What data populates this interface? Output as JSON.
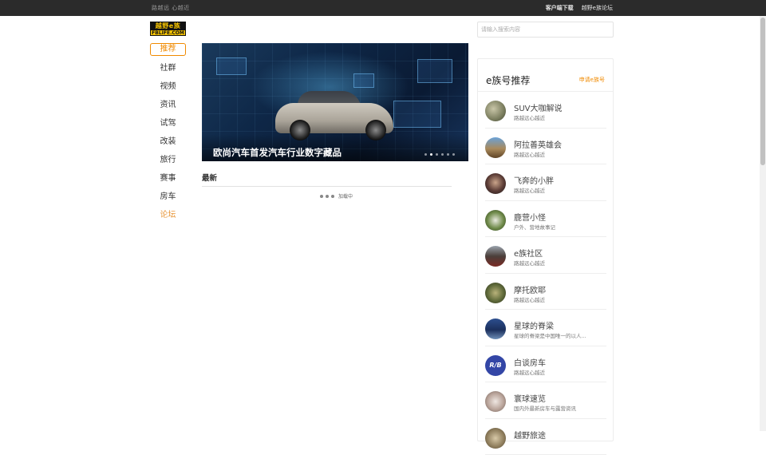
{
  "topbar": {
    "slogan": "路越远 心越近",
    "client_download": "客户端下载",
    "forum": "越野e族论坛"
  },
  "logo": {
    "cn": "越野e族",
    "en": "FBLIFE.COM"
  },
  "nav": {
    "items": [
      "推荐",
      "社群",
      "视频",
      "资讯",
      "试驾",
      "改装",
      "旅行",
      "赛事",
      "房车",
      "论坛"
    ]
  },
  "banner": {
    "caption": "欧尚汽车首发汽车行业数字藏品",
    "slide_count": 6,
    "active_slide": 1
  },
  "latest": {
    "title": "最新",
    "loading": "加载中"
  },
  "search": {
    "placeholder": "请输入搜索内容"
  },
  "recommend": {
    "title": "e族号推荐",
    "apply": "申请e族号",
    "items": [
      {
        "name": "SUV大咖解说",
        "desc": "路越远心越近",
        "avatar_icon": "suv-avatar-icon"
      },
      {
        "name": "阿拉善英雄会",
        "desc": "路越远心越近",
        "avatar_icon": "alashan-avatar-icon"
      },
      {
        "name": "飞奔的小胖",
        "desc": "路越远心越近",
        "avatar_icon": "feiben-avatar-icon"
      },
      {
        "name": "鹿营小怪",
        "desc": "户外、营地故事记",
        "avatar_icon": "luying-avatar-icon"
      },
      {
        "name": "e族社区",
        "desc": "路越远心越近",
        "avatar_icon": "ezu-avatar-icon"
      },
      {
        "name": "摩托欧耶",
        "desc": "路越远心越近",
        "avatar_icon": "moto-avatar-icon"
      },
      {
        "name": "星球的脊梁",
        "desc": "星球的脊梁是中国唯一的以人...",
        "avatar_icon": "xingqiu-avatar-icon"
      },
      {
        "name": "白谈房车",
        "desc": "路越远心越近",
        "avatar_icon": "rvb-avatar-icon"
      },
      {
        "name": "寰球速览",
        "desc": "国内外最新房车与露营资讯",
        "avatar_icon": "huanqiu-avatar-icon"
      },
      {
        "name": "越野旅途",
        "desc": "",
        "avatar_icon": "lvtu-avatar-icon"
      }
    ]
  },
  "colors": {
    "accent": "#f08a00",
    "topbar_bg": "#2b2b2b",
    "logo_yellow": "#f6c400"
  }
}
